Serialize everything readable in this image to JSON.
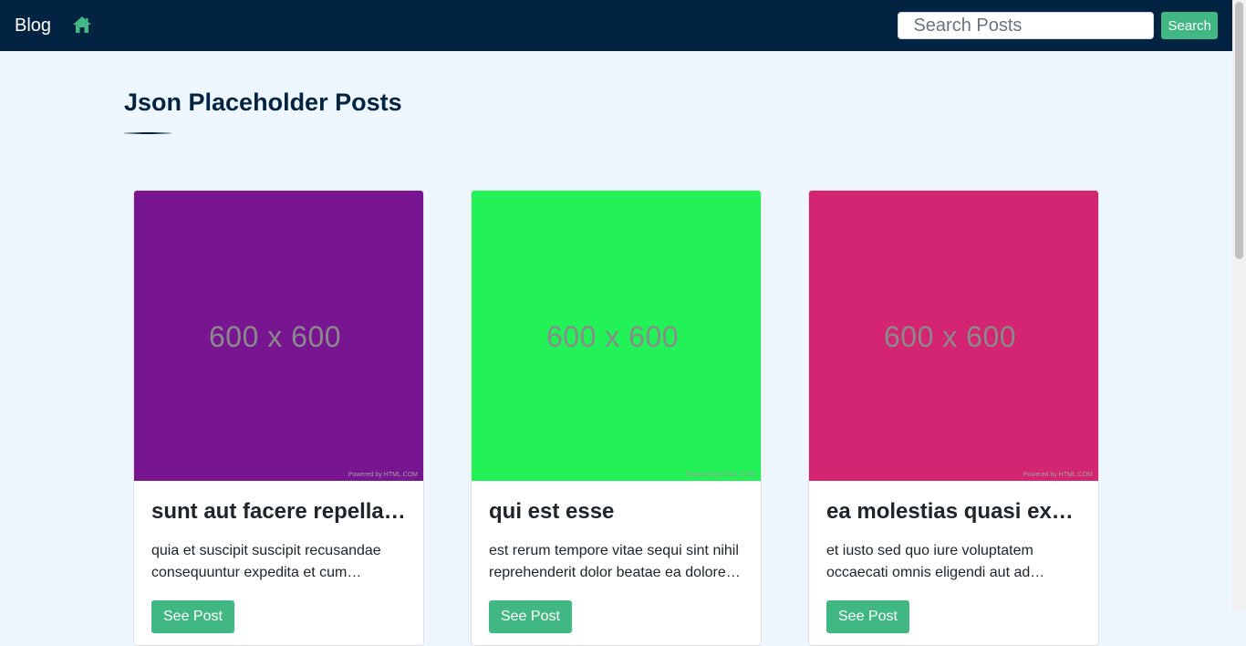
{
  "navbar": {
    "brand": "Blog",
    "home_icon": "home-icon",
    "search": {
      "placeholder": "Search Posts",
      "value": "",
      "button_label": "Search"
    }
  },
  "page": {
    "title": "Json Placeholder Posts"
  },
  "colors": {
    "navbar_bg": "#022341",
    "accent": "#41b883",
    "page_bg": "#eef6ff"
  },
  "posts": [
    {
      "image_label": "600 x 600",
      "image_credit": "Powered by HTML.COM",
      "image_color": "#781692",
      "title": "sunt aut facere repellat provident occaecati excepturi optio reprehenderit",
      "body": "quia et suscipit suscipit recusandae consequuntur expedita et cum reprehenderit molestiae ut ut quas totam",
      "button_label": "See Post"
    },
    {
      "image_label": "600 x 600",
      "image_credit": "Powered by HTML.COM",
      "image_color": "#22f257",
      "title": "qui est esse",
      "body": "est rerum tempore vitae sequi sint nihil reprehenderit dolor beatae ea dolores neque fugiat blanditiis voluptate",
      "button_label": "See Post"
    },
    {
      "image_label": "600 x 600",
      "image_credit": "Powered by HTML.COM",
      "image_color": "#d32572",
      "title": "ea molestias quasi exercitationem repellat qui ipsa sit aut",
      "body": "et iusto sed quo iure voluptatem occaecati omnis eligendi aut ad voluptatem doloribus vel accusantium quis",
      "button_label": "See Post"
    }
  ]
}
